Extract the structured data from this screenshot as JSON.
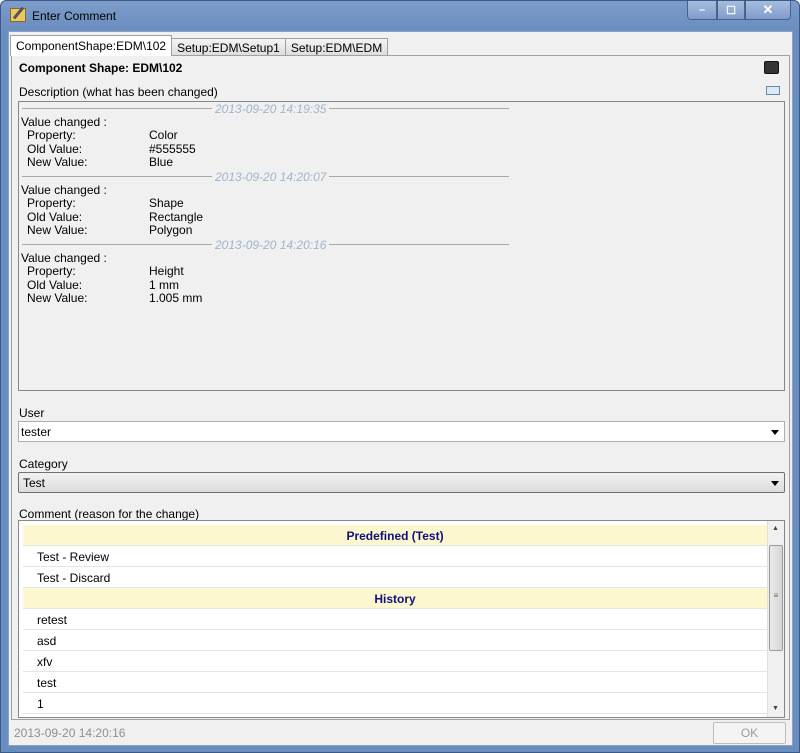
{
  "window": {
    "title": "Enter Comment",
    "minimize": "–",
    "maximize": "☐",
    "close": "✕"
  },
  "tabs": [
    {
      "label": "ComponentShape:EDM\\102"
    },
    {
      "label": "Setup:EDM\\Setup1"
    },
    {
      "label": "Setup:EDM\\EDM"
    }
  ],
  "header": {
    "title": "Component Shape: EDM\\102",
    "description_label": "Description (what has been changed)"
  },
  "labels": {
    "value_changed": "Value changed :",
    "property": "Property:",
    "old_value": "Old Value:",
    "new_value": "New Value:"
  },
  "changes": [
    {
      "timestamp": "2013-09-20 14:19:35",
      "property": "Color",
      "old_value": "#555555",
      "new_value": "Blue"
    },
    {
      "timestamp": "2013-09-20 14:20:07",
      "property": "Shape",
      "old_value": "Rectangle",
      "new_value": "Polygon"
    },
    {
      "timestamp": "2013-09-20 14:20:16",
      "property": "Height",
      "old_value": "1 mm",
      "new_value": "1.005 mm"
    }
  ],
  "user": {
    "label": "User",
    "value": "tester"
  },
  "category": {
    "label": "Category",
    "value": "Test"
  },
  "comment": {
    "label": "Comment (reason for the change)",
    "predefined_header": "Predefined (Test)",
    "predefined": [
      "Test - Review",
      "Test - Discard"
    ],
    "history_header": "History",
    "history": [
      "retest",
      "asd",
      "xfv",
      "test",
      "1"
    ]
  },
  "footer": {
    "timestamp": "2013-09-20 14:20:16",
    "ok_label": "OK"
  }
}
